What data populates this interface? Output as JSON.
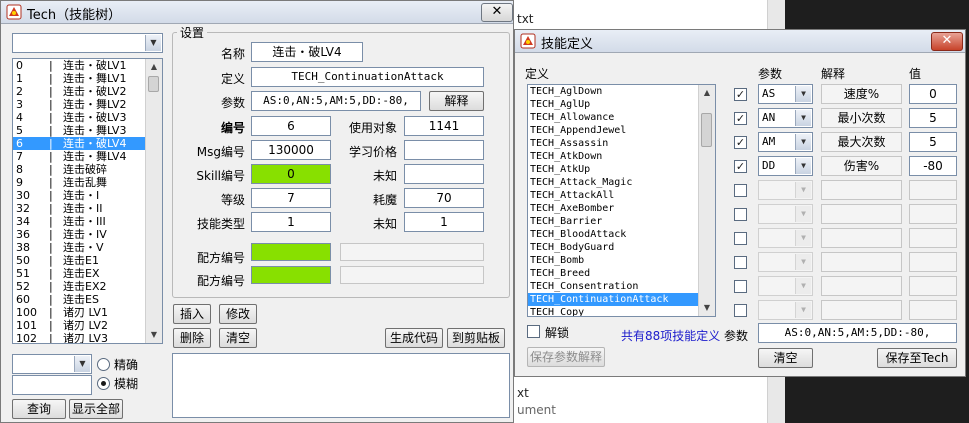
{
  "bg_window": {
    "line1": "txt",
    "line2": "xt",
    "line3": "ument"
  },
  "tech_window": {
    "title": "Tech（技能树）",
    "close": "✕",
    "filter_combo": "",
    "skills": [
      {
        "id": "0",
        "name": "连击・破LV1"
      },
      {
        "id": "1",
        "name": "连击・舞LV1"
      },
      {
        "id": "2",
        "name": "连击・破LV2"
      },
      {
        "id": "3",
        "name": "连击・舞LV2"
      },
      {
        "id": "4",
        "name": "连击・破LV3"
      },
      {
        "id": "5",
        "name": "连击・舞LV3"
      },
      {
        "id": "6",
        "name": "连击・破LV4"
      },
      {
        "id": "7",
        "name": "连击・舞LV4"
      },
      {
        "id": "8",
        "name": "连击破碎"
      },
      {
        "id": "9",
        "name": "连击乱舞"
      },
      {
        "id": "30",
        "name": "连击・I"
      },
      {
        "id": "32",
        "name": "连击・II"
      },
      {
        "id": "34",
        "name": "连击・III"
      },
      {
        "id": "36",
        "name": "连击・IV"
      },
      {
        "id": "38",
        "name": "连击・V"
      },
      {
        "id": "50",
        "name": "连击E1"
      },
      {
        "id": "51",
        "name": "连击EX"
      },
      {
        "id": "52",
        "name": "连击EX2"
      },
      {
        "id": "60",
        "name": "连击ES"
      },
      {
        "id": "100",
        "name": "诸刃 LV1"
      },
      {
        "id": "101",
        "name": "诸刃 LV2"
      },
      {
        "id": "102",
        "name": "诸刃 LV3"
      }
    ],
    "selected_index": 6,
    "search": {
      "combo": "",
      "input": "",
      "radio_exact": "精确",
      "radio_fuzzy": "模糊",
      "query_btn": "查询",
      "showall_btn": "显示全部"
    },
    "settings": {
      "group": "设置",
      "name_lbl": "名称",
      "name_val": "连击・破LV4",
      "def_lbl": "定义",
      "def_val": "TECH_ContinuationAttack",
      "param_lbl": "参数",
      "param_val": "AS:0,AN:5,AM:5,DD:-80,",
      "explain_btn": "解释",
      "num_lbl": "编号",
      "num_val": "6",
      "target_lbl": "使用对象",
      "target_val": "1141",
      "msg_lbl": "Msg编号",
      "msg_val": "130000",
      "learn_lbl": "学习价格",
      "learn_val": "",
      "skillno_lbl": "Skill编号",
      "skillno_val": "0",
      "unknown1_lbl": "未知",
      "unknown1_val": "",
      "level_lbl": "等级",
      "level_val": "7",
      "mp_lbl": "耗魔",
      "mp_val": "70",
      "type_lbl": "技能类型",
      "type_val": "1",
      "unknown2_lbl": "未知",
      "unknown2_val": "1",
      "recipe1_lbl": "配方编号",
      "recipe2_lbl": "配方编号"
    },
    "buttons": {
      "insert": "插入",
      "modify": "修改",
      "delete": "删除",
      "clear": "清空",
      "gen": "生成代码",
      "clip": "到剪贴板"
    },
    "code_text": ""
  },
  "def_window": {
    "title": "技能定义",
    "close": "✕",
    "def_lbl": "定义",
    "param_hdr": "参数",
    "explain_hdr": "解释",
    "value_hdr": "值",
    "definitions": [
      "TECH_AglDown",
      "TECH_AglUp",
      "TECH_Allowance",
      "TECH_AppendJewel",
      "TECH_Assassin",
      "TECH_AtkDown",
      "TECH_AtkUp",
      "TECH_Attack_Magic",
      "TECH_AttackAll",
      "TECH_AxeBomber",
      "TECH_Barrier",
      "TECH_BloodAttack",
      "TECH_BodyGuard",
      "TECH_Bomb",
      "TECH_Breed",
      "TECH_Consentration",
      "TECH_ContinuationAttack",
      "TECH_Copy"
    ],
    "selected_def": 16,
    "params": [
      {
        "checked": true,
        "code": "AS",
        "desc": "速度%",
        "value": "0"
      },
      {
        "checked": true,
        "code": "AN",
        "desc": "最小次数",
        "value": "5"
      },
      {
        "checked": true,
        "code": "AM",
        "desc": "最大次数",
        "value": "5"
      },
      {
        "checked": true,
        "code": "DD",
        "desc": "伤害%",
        "value": "-80"
      },
      {
        "checked": false,
        "code": "",
        "desc": "",
        "value": ""
      },
      {
        "checked": false,
        "code": "",
        "desc": "",
        "value": ""
      },
      {
        "checked": false,
        "code": "",
        "desc": "",
        "value": ""
      },
      {
        "checked": false,
        "code": "",
        "desc": "",
        "value": ""
      },
      {
        "checked": false,
        "code": "",
        "desc": "",
        "value": ""
      },
      {
        "checked": false,
        "code": "",
        "desc": "",
        "value": ""
      }
    ],
    "unlock_lbl": "解锁",
    "count_lbl": "共有88项技能定义",
    "param_lbl": "参数",
    "param_val": "AS:0,AN:5,AM:5,DD:-80,",
    "save_explain_btn": "保存参数解释",
    "clear_btn": "清空",
    "save_btn": "保存至Tech",
    "check_mark": "✓"
  },
  "colors": {
    "selection": "#3399ff",
    "green_field": "#88e000",
    "count_text": "#1a1acc"
  }
}
